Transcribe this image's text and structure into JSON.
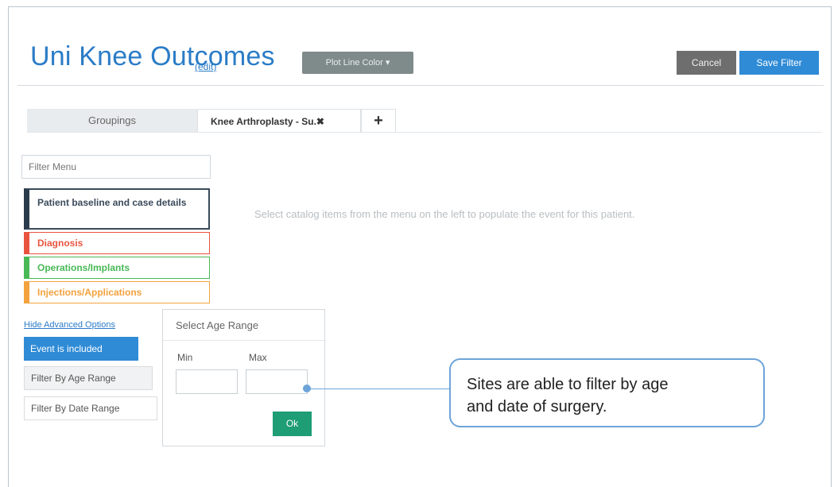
{
  "header": {
    "title": "Uni Knee Outcomes",
    "edit_link": "(edit)",
    "plot_line_color": "Plot Line Color ▾",
    "cancel": "Cancel",
    "save_filter": "Save Filter"
  },
  "tabs": [
    {
      "label": "Groupings"
    },
    {
      "label": "Knee Arthroplasty - Su.✖"
    },
    {
      "label": "+"
    }
  ],
  "sidebar": {
    "filter_placeholder": "Filter Menu",
    "categories": [
      {
        "label": "Patient baseline and case details",
        "color": "#2a3b4c"
      },
      {
        "label": "Diagnosis",
        "color": "#e9543f"
      },
      {
        "label": "Operations/Implants",
        "color": "#48b955"
      },
      {
        "label": "Injections/Applications",
        "color": "#f3a23d"
      }
    ],
    "advanced_link": "Hide Advanced Options",
    "event_included": "Event is included",
    "filter_age": "Filter By Age Range",
    "filter_date": "Filter By Date Range"
  },
  "main": {
    "hint": "Select catalog items from the menu on the left to populate the event for this patient."
  },
  "age_popover": {
    "title": "Select Age Range",
    "min_label": "Min",
    "max_label": "Max",
    "ok": "Ok"
  },
  "callout": {
    "line1": "Sites are able to filter by age",
    "line2": "and date of surgery."
  },
  "colors": {
    "accent": "#2f8bd6",
    "ok_green": "#1f9d74",
    "callout_border": "#6da4d8"
  }
}
